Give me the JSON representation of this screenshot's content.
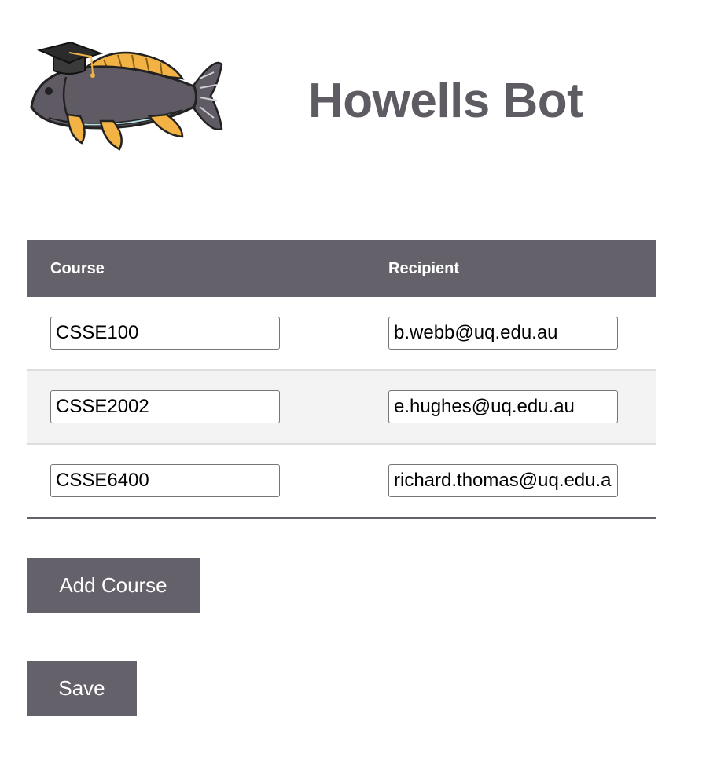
{
  "header": {
    "title": "Howells Bot",
    "logo_icon": "graduate-carp-fish-icon"
  },
  "colors": {
    "accent": "#65616a",
    "title": "#5f5b62",
    "fish_body": "#5f5a63",
    "fish_fin": "#f2b244"
  },
  "table": {
    "columns": [
      "Course",
      "Recipient"
    ],
    "rows": [
      {
        "course": "CSSE100",
        "recipient": "b.webb@uq.edu.au"
      },
      {
        "course": "CSSE2002",
        "recipient": "e.hughes@uq.edu.au"
      },
      {
        "course": "CSSE6400",
        "recipient": "richard.thomas@uq.edu.au"
      }
    ]
  },
  "actions": {
    "add_label": "Add Course",
    "save_label": "Save"
  }
}
